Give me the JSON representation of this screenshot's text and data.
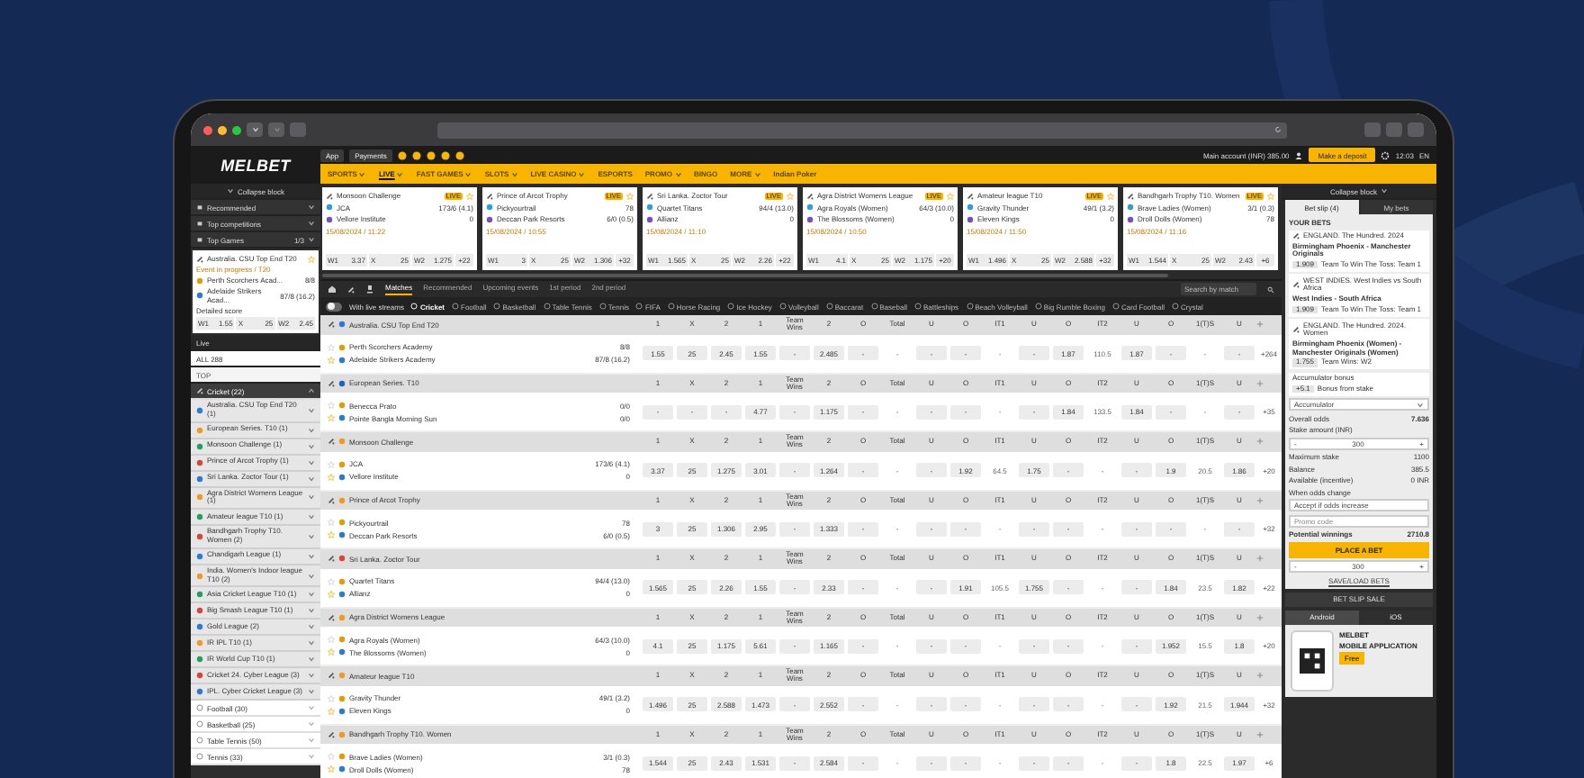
{
  "header": {
    "logo": "MELBET",
    "app_button": "App",
    "payments_button": "Payments",
    "account": "Main account (INR) 385.00",
    "deposit_button": "Make a deposit",
    "time": "12:03",
    "language": "EN"
  },
  "nav": [
    {
      "label": "SPORTS",
      "selected": false,
      "dropdown": true
    },
    {
      "label": "LIVE",
      "selected": true,
      "dropdown": true
    },
    {
      "label": "FAST GAMES",
      "selected": false,
      "dropdown": true
    },
    {
      "label": "SLOTS",
      "selected": false,
      "dropdown": true
    },
    {
      "label": "LIVE CASINO",
      "selected": false,
      "dropdown": true
    },
    {
      "label": "ESPORTS",
      "selected": false,
      "dropdown": false
    },
    {
      "label": "PROMO",
      "selected": false,
      "dropdown": true
    },
    {
      "label": "BINGO",
      "selected": false,
      "dropdown": false
    },
    {
      "label": "MORE",
      "selected": false,
      "dropdown": true
    },
    {
      "label": "Indian Poker",
      "selected": false,
      "dropdown": false
    }
  ],
  "sidebar": {
    "collapse": "Collapse block",
    "sections": [
      {
        "label": "Recommended"
      },
      {
        "label": "Top competitions"
      },
      {
        "label": "Top Games",
        "count": "1/3"
      }
    ],
    "game_card": {
      "league": "Australia. CSU Top End T20",
      "status": "Event in progress / T20",
      "teams": [
        {
          "name": "Perth Scorchers Acad...",
          "score": "8/8"
        },
        {
          "name": "Adelaide Strikers Acad...",
          "score": "87/8 (16.2)"
        }
      ],
      "detail": "Detailed score",
      "odds": [
        {
          "label": "W1",
          "value": "1.55"
        },
        {
          "label": "X",
          "value": "25"
        },
        {
          "label": "W2",
          "value": "2.45"
        }
      ]
    },
    "live_label": "Live",
    "filter_all": "ALL 288",
    "top_label": "TOP",
    "sports": [
      {
        "label": "Cricket (22)",
        "expanded": true,
        "leagues": [
          "Australia. CSU Top End T20 (1)",
          "European Series. T10 (1)",
          "Monsoon Challenge (1)",
          "Prince of Arcot Trophy (1)",
          "Sri Lanka. Zoctor Tour (1)",
          "Agra District Womens League (1)",
          "Amateur league T10 (1)",
          "Bandhgarh Trophy T10. Women (2)",
          "Chandigarh League (1)",
          "India. Women's Indoor league T10 (2)",
          "Asia Cricket League T10 (1)",
          "Big Smash League T10 (1)",
          "Gold League (2)",
          "IR IPL T10 (1)",
          "IR World Cup T10 (1)",
          "Cricket 24. Cyber League (3)",
          "IPL. Cyber Cricket League (3)"
        ]
      },
      {
        "label": "Football (30)",
        "expanded": false
      },
      {
        "label": "Basketball (25)",
        "expanded": false
      },
      {
        "label": "Table Tennis (50)",
        "expanded": false
      },
      {
        "label": "Tennis (33)",
        "expanded": false
      }
    ]
  },
  "featured": [
    {
      "league": "Monsoon Challenge",
      "badge": "LIVE",
      "teams": [
        {
          "name": "JCA",
          "score": "173/6 (4.1)"
        },
        {
          "name": "Vellore Institute",
          "score": "0"
        }
      ],
      "date": "15/08/2024 / 11:22",
      "odds": [
        {
          "label": "W1",
          "value": "3.37"
        },
        {
          "label": "X",
          "value": "25"
        },
        {
          "label": "W2",
          "value": "1.275"
        }
      ],
      "more": "+22"
    },
    {
      "league": "Prince of Arcot Trophy",
      "badge": "LIVE",
      "teams": [
        {
          "name": "Pickyourtrail",
          "score": "78"
        },
        {
          "name": "Deccan Park Resorts",
          "score": "6/0 (0.5)"
        }
      ],
      "date": "15/08/2024 / 10:55",
      "odds": [
        {
          "label": "W1",
          "value": "3"
        },
        {
          "label": "X",
          "value": "25"
        },
        {
          "label": "W2",
          "value": "1.306"
        }
      ],
      "more": "+32"
    },
    {
      "league": "Sri Lanka. Zoctor Tour",
      "badge": "LIVE",
      "teams": [
        {
          "name": "Quartet Titans",
          "score": "94/4 (13.0)"
        },
        {
          "name": "Allianz",
          "score": "0"
        }
      ],
      "date": "15/08/2024 / 11:10",
      "odds": [
        {
          "label": "W1",
          "value": "1.565"
        },
        {
          "label": "X",
          "value": "25"
        },
        {
          "label": "W2",
          "value": "2.26"
        }
      ],
      "more": "+22"
    },
    {
      "league": "Agra District Womens League",
      "badge": "LIVE",
      "teams": [
        {
          "name": "Agra Royals (Women)",
          "score": "64/3 (10.0)"
        },
        {
          "name": "The Blossoms (Women)",
          "score": "0"
        }
      ],
      "date": "15/08/2024 / 10:50",
      "odds": [
        {
          "label": "W1",
          "value": "4.1"
        },
        {
          "label": "X",
          "value": "25"
        },
        {
          "label": "W2",
          "value": "1.175"
        }
      ],
      "more": "+20"
    },
    {
      "league": "Amateur league T10",
      "badge": "LIVE",
      "teams": [
        {
          "name": "Gravity Thunder",
          "score": "49/1 (3.2)"
        },
        {
          "name": "Eleven Kings",
          "score": "0"
        }
      ],
      "date": "15/08/2024 / 11:50",
      "odds": [
        {
          "label": "W1",
          "value": "1.496"
        },
        {
          "label": "X",
          "value": "25"
        },
        {
          "label": "W2",
          "value": "2.588"
        }
      ],
      "more": "+32"
    },
    {
      "league": "Bandhgarh Trophy T10. Women",
      "badge": "LIVE",
      "teams": [
        {
          "name": "Brave Ladies (Women)",
          "score": "3/1 (0.3)"
        },
        {
          "name": "Droll Dolls (Women)",
          "score": "78"
        }
      ],
      "date": "15/08/2024 / 11:16",
      "odds": [
        {
          "label": "W1",
          "value": "1.544"
        },
        {
          "label": "X",
          "value": "25"
        },
        {
          "label": "W2",
          "value": "2.43"
        }
      ],
      "more": "+6"
    }
  ],
  "toolbar": {
    "tabs": [
      {
        "label": "Matches",
        "selected": true
      },
      {
        "label": "Recommended",
        "selected": false
      },
      {
        "label": "Upcoming events",
        "selected": false
      },
      {
        "label": "1st period",
        "selected": false
      },
      {
        "label": "2nd period",
        "selected": false
      }
    ],
    "search": {
      "placeholder": "Search by match"
    }
  },
  "filters": {
    "stream_label": "With live streams",
    "stream_on": false,
    "sports": [
      {
        "label": "Cricket",
        "selected": true
      },
      {
        "label": "Football",
        "selected": false
      },
      {
        "label": "Basketball",
        "selected": false
      },
      {
        "label": "Table Tennis",
        "selected": false
      },
      {
        "label": "Tennis",
        "selected": false
      },
      {
        "label": "FIFA",
        "selected": false
      },
      {
        "label": "Horse Racing",
        "selected": false
      },
      {
        "label": "Ice Hockey",
        "selected": false
      },
      {
        "label": "Volleyball",
        "selected": false
      },
      {
        "label": "Baccarat",
        "selected": false
      },
      {
        "label": "Baseball",
        "selected": false
      },
      {
        "label": "Battleships",
        "selected": false
      },
      {
        "label": "Beach Volleyball",
        "selected": false
      },
      {
        "label": "Big Rumble Boxing",
        "selected": false
      },
      {
        "label": "Card Football",
        "selected": false
      },
      {
        "label": "Crystal",
        "selected": false
      }
    ]
  },
  "groups": [
    {
      "league": "Australia. CSU Top End T20",
      "columns": [
        "1",
        "X",
        "2",
        "1",
        "Team Wins",
        "2",
        "O",
        "Total",
        "U",
        "O",
        "IT1",
        "U",
        "O",
        "IT2",
        "U",
        "O",
        "1(T)S",
        "U"
      ],
      "teams": [
        {
          "name": "Perth Scorchers Academy",
          "score": "8/8"
        },
        {
          "name": "Adelaide Strikers Academy",
          "score": "87/8 (16.2)"
        }
      ],
      "odds": [
        "1.55",
        "25",
        "2.45",
        "1.55",
        "-",
        "2.485",
        "-",
        "-",
        "-",
        "-",
        "-",
        "-",
        "1.87",
        "110.5",
        "1.87",
        "-",
        "-",
        "-"
      ],
      "more": "+264"
    },
    {
      "league": "European Series. T10",
      "columns": [
        "1",
        "X",
        "2",
        "1",
        "Team Wins",
        "2",
        "O",
        "Total",
        "U",
        "O",
        "IT1",
        "U",
        "O",
        "IT2",
        "U",
        "O",
        "1(T)S",
        "U"
      ],
      "teams": [
        {
          "name": "Benecca Prato",
          "score": "0/0"
        },
        {
          "name": "Pointe Bangla Morning Sun",
          "score": "0/0"
        }
      ],
      "odds": [
        "-",
        "-",
        "-",
        "4.77",
        "-",
        "1.175",
        "-",
        "-",
        "-",
        "-",
        "-",
        "-",
        "1.84",
        "133.5",
        "1.84",
        "-",
        "-",
        "-"
      ],
      "more": "+35"
    },
    {
      "league": "Monsoon Challenge",
      "columns": [
        "1",
        "X",
        "2",
        "1",
        "Team Wins",
        "2",
        "O",
        "Total",
        "U",
        "O",
        "IT1",
        "U",
        "O",
        "IT2",
        "U",
        "O",
        "1(T)S",
        "U"
      ],
      "teams": [
        {
          "name": "JCA",
          "score": "173/6 (4.1)"
        },
        {
          "name": "Vellore Institute",
          "score": "0"
        }
      ],
      "odds": [
        "3.37",
        "25",
        "1.275",
        "3.01",
        "-",
        "1.264",
        "-",
        "-",
        "-",
        "1.92",
        "64.5",
        "1.75",
        "-",
        "-",
        "-",
        "1.9",
        "20.5",
        "1.86"
      ],
      "more": "+20"
    },
    {
      "league": "Prince of Arcot Trophy",
      "columns": [
        "1",
        "X",
        "2",
        "1",
        "Team Wins",
        "2",
        "O",
        "Total",
        "U",
        "O",
        "IT1",
        "U",
        "O",
        "IT2",
        "U",
        "O",
        "1(T)S",
        "U"
      ],
      "teams": [
        {
          "name": "Pickyourtrail",
          "score": "78"
        },
        {
          "name": "Deccan Park Resorts",
          "score": "6/0 (0.5)"
        }
      ],
      "odds": [
        "3",
        "25",
        "1.306",
        "2.95",
        "-",
        "1.333",
        "-",
        "-",
        "-",
        "-",
        "-",
        "-",
        "-",
        "-",
        "-",
        "-",
        "-",
        "-"
      ],
      "more": "+32"
    },
    {
      "league": "Sri Lanka. Zoctor Tour",
      "columns": [
        "1",
        "X",
        "2",
        "1",
        "Team Wins",
        "2",
        "O",
        "Total",
        "U",
        "O",
        "IT1",
        "U",
        "O",
        "IT2",
        "U",
        "O",
        "1(T)S",
        "U"
      ],
      "teams": [
        {
          "name": "Quartet Titans",
          "score": "94/4 (13.0)"
        },
        {
          "name": "Allianz",
          "score": "0"
        }
      ],
      "odds": [
        "1.565",
        "25",
        "2.26",
        "1.55",
        "-",
        "2.33",
        "-",
        "-",
        "-",
        "1.91",
        "105.5",
        "1.755",
        "-",
        "-",
        "-",
        "1.84",
        "23.5",
        "1.82"
      ],
      "more": "+22"
    },
    {
      "league": "Agra District Womens League",
      "columns": [
        "1",
        "X",
        "2",
        "1",
        "Team Wins",
        "2",
        "O",
        "Total",
        "U",
        "O",
        "IT1",
        "U",
        "O",
        "IT2",
        "U",
        "O",
        "1(T)S",
        "U"
      ],
      "teams": [
        {
          "name": "Agra Royals (Women)",
          "score": "64/3 (10.0)"
        },
        {
          "name": "The Blossoms (Women)",
          "score": "0"
        }
      ],
      "odds": [
        "4.1",
        "25",
        "1.175",
        "5.61",
        "-",
        "1.165",
        "-",
        "-",
        "-",
        "-",
        "-",
        "-",
        "-",
        "-",
        "-",
        "1.952",
        "15.5",
        "1.8"
      ],
      "more": "+20"
    },
    {
      "league": "Amateur league T10",
      "columns": [
        "1",
        "X",
        "2",
        "1",
        "Team Wins",
        "2",
        "O",
        "Total",
        "U",
        "O",
        "IT1",
        "U",
        "O",
        "IT2",
        "U",
        "O",
        "1(T)S",
        "U"
      ],
      "teams": [
        {
          "name": "Gravity Thunder",
          "score": "49/1 (3.2)"
        },
        {
          "name": "Eleven Kings",
          "score": "0"
        }
      ],
      "odds": [
        "1.496",
        "25",
        "2.588",
        "1.473",
        "-",
        "2.552",
        "-",
        "-",
        "-",
        "-",
        "-",
        "-",
        "-",
        "-",
        "-",
        "1.92",
        "21.5",
        "1.944"
      ],
      "more": "+32"
    },
    {
      "league": "Bandhgarh Trophy T10. Women",
      "columns": [
        "1",
        "X",
        "2",
        "1",
        "Team Wins",
        "2",
        "O",
        "Total",
        "U",
        "O",
        "IT1",
        "U",
        "O",
        "IT2",
        "U",
        "O",
        "1(T)S",
        "U"
      ],
      "teams": [
        {
          "name": "Brave Ladies (Women)",
          "score": "3/1 (0.3)"
        },
        {
          "name": "Droll Dolls (Women)",
          "score": "78"
        }
      ],
      "odds": [
        "1.544",
        "25",
        "2.43",
        "1.531",
        "-",
        "2.584",
        "-",
        "-",
        "-",
        "-",
        "-",
        "-",
        "-",
        "-",
        "-",
        "1.8",
        "22.5",
        "1.97"
      ],
      "more": "+6"
    }
  ],
  "bet_slip": {
    "collapse": "Collapse block",
    "tabs": [
      {
        "label": "Bet slip (4)",
        "selected": true
      },
      {
        "label": "My bets",
        "selected": false
      }
    ],
    "heading": "YOUR BETS",
    "bets": [
      {
        "event": "ENGLAND. The Hundred. 2024",
        "match": "Birmingham Phoenix - Manchester Originals",
        "odds": "1.909",
        "market": "Team To Win The Toss: Team 1"
      },
      {
        "event": "WEST INDIES. West Indies vs South Africa",
        "match": "West Indies - South Africa",
        "odds": "1.909",
        "market": "Team To Win The Toss: Team 1"
      },
      {
        "event": "ENGLAND. The Hundred. 2024. Women",
        "match": "Birmingham Phoenix (Women) - Manchester Originals (Women)",
        "odds": "1.755",
        "market": "Team Wins: W2"
      }
    ],
    "bonus": {
      "title": "Accumulator bonus",
      "value": "+5.1",
      "note": "Bonus from stake"
    },
    "bet_type": "Accumulator",
    "overall_odds": {
      "label": "Overall odds",
      "value": "7.636"
    },
    "stake": {
      "label": "Stake amount (INR)",
      "minus": "-",
      "value": "300",
      "plus": "+"
    },
    "info": [
      {
        "label": "Maximum stake",
        "value": "1100"
      },
      {
        "label": "Balance",
        "value": "385.5"
      },
      {
        "label": "Available (incentive)",
        "value": "0 INR"
      }
    ],
    "odds_change_label": "When odds change",
    "odds_change": "Accept if odds increase",
    "promo": {
      "placeholder": "Promo code"
    },
    "potential": {
      "label": "Potential winnings",
      "value": "2710.8"
    },
    "place_button": "PLACE A BET",
    "quick_stake": {
      "minus": "-",
      "value": "300",
      "plus": "+"
    },
    "save_button": "SAVE/LOAD BETS",
    "sale_button": "BET SLIP SALE",
    "app_tabs": [
      {
        "label": "Android",
        "selected": true
      },
      {
        "label": "iOS",
        "selected": false
      }
    ],
    "app_promo": {
      "brand": "MELBET",
      "title": "MOBILE APPLICATION",
      "button": "Free"
    }
  }
}
